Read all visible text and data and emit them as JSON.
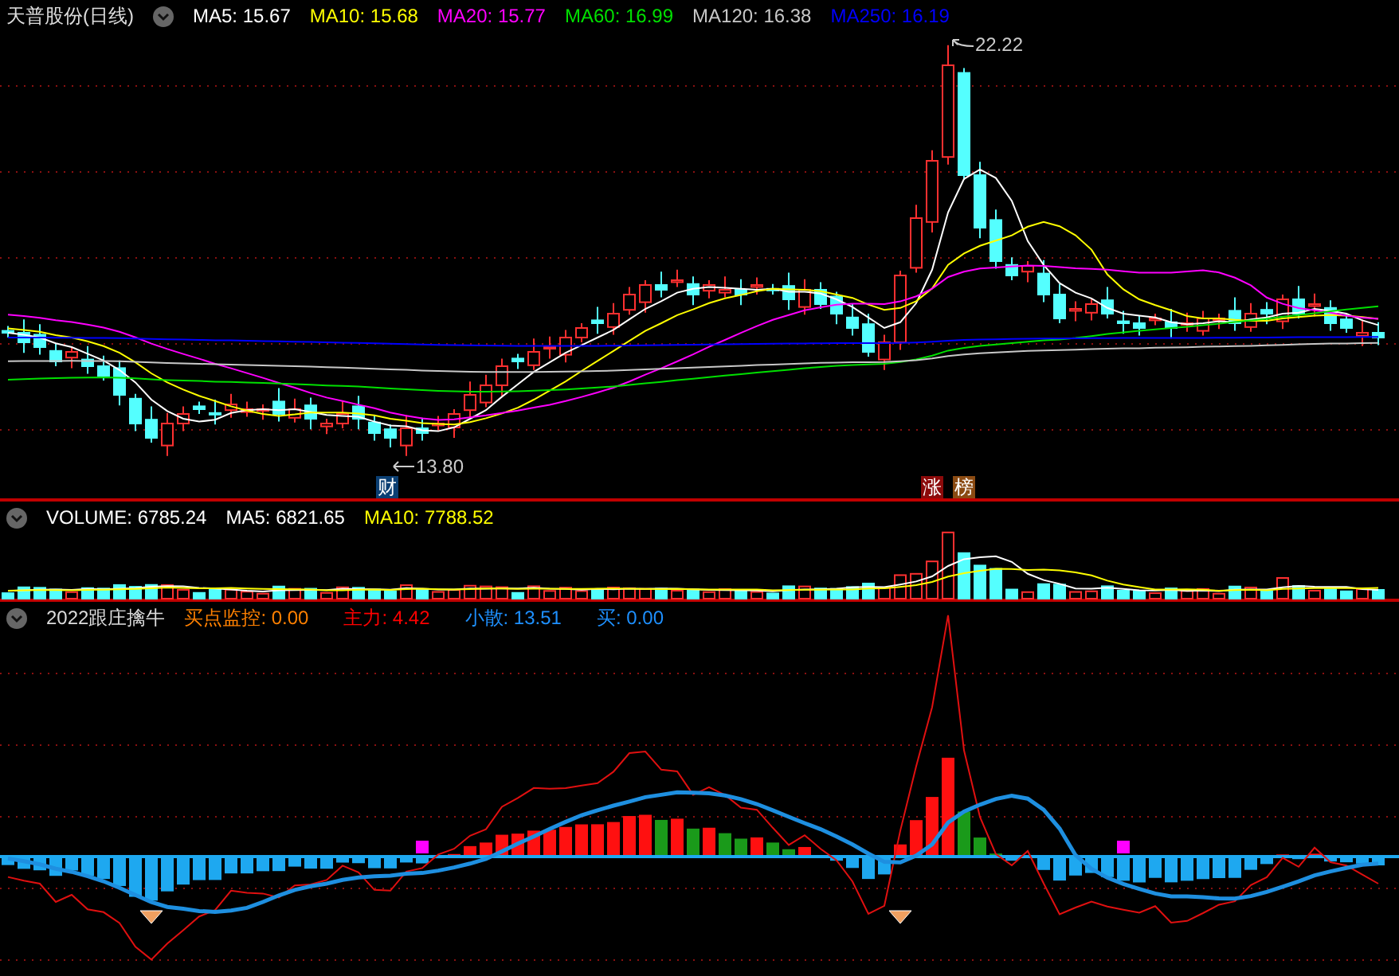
{
  "stock": {
    "name": "天普股份(日线)"
  },
  "main_indicators": [
    {
      "label": "MA5: 15.67",
      "color": "#ffffff"
    },
    {
      "label": "MA10: 15.68",
      "color": "#ffff00"
    },
    {
      "label": "MA20: 15.77",
      "color": "#ff00ff"
    },
    {
      "label": "MA60: 16.99",
      "color": "#00e000"
    },
    {
      "label": "MA120: 16.38",
      "color": "#c8c8c8"
    },
    {
      "label": "MA250: 16.19",
      "color": "#0000ff"
    }
  ],
  "main_annotations": {
    "high": "22.22",
    "low": "13.80",
    "badges": [
      {
        "text": "财",
        "color": "#0b3f73"
      },
      {
        "text": "涨",
        "color": "#8b0a0a"
      },
      {
        "text": "榜",
        "color": "#8a4a12"
      }
    ]
  },
  "volume_panel": {
    "indicators": [
      {
        "label": "VOLUME: 6785.24",
        "color": "#ffffff"
      },
      {
        "label": "MA5: 6821.65",
        "color": "#ffffff"
      },
      {
        "label": "MA10: 7788.52",
        "color": "#ffff00"
      }
    ]
  },
  "indicator_panel": {
    "title": "2022跟庄擒牛",
    "indicators": [
      {
        "label": "买点监控: 0.00",
        "color": "#ff8000"
      },
      {
        "label": "主力: 4.42",
        "color": "#ff0000"
      },
      {
        "label": "小散: 13.51",
        "color": "#1e90ff"
      },
      {
        "label": "买: 0.00",
        "color": "#1e90ff"
      }
    ]
  }
}
